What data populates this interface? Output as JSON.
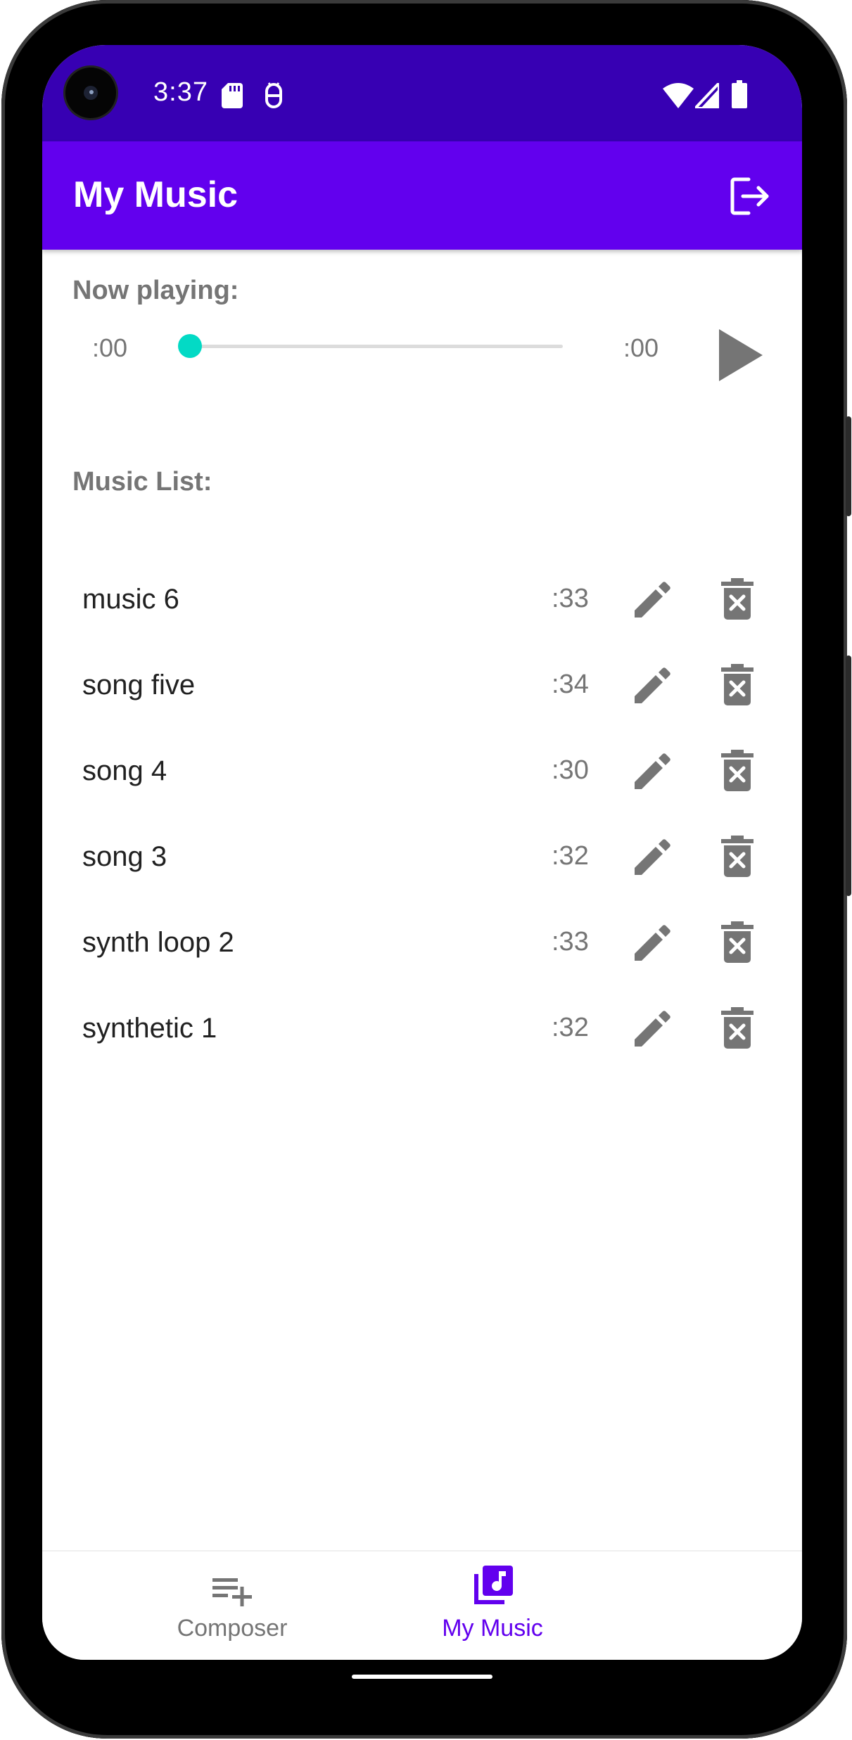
{
  "status_bar": {
    "time": "3:37",
    "icons": [
      "sd-card-icon",
      "debug-icon",
      "wifi-icon",
      "signal-icon",
      "battery-icon"
    ]
  },
  "app_bar": {
    "title": "My Music",
    "action_icon": "logout-icon"
  },
  "player": {
    "label": "Now playing:",
    "current_time": ":00",
    "total_time": ":00",
    "progress": 0,
    "play_icon": "play-icon"
  },
  "music_list": {
    "label": "Music List:",
    "items": [
      {
        "name": "music 6",
        "duration": ":33"
      },
      {
        "name": "song five",
        "duration": ":34"
      },
      {
        "name": "song 4",
        "duration": ":30"
      },
      {
        "name": "song 3",
        "duration": ":32"
      },
      {
        "name": "synth loop 2",
        "duration": ":33"
      },
      {
        "name": "synthetic 1",
        "duration": ":32"
      }
    ]
  },
  "bottom_nav": {
    "items": [
      {
        "label": "Composer",
        "icon": "playlist-add-icon",
        "selected": false
      },
      {
        "label": "My Music",
        "icon": "library-music-icon",
        "selected": true
      }
    ]
  },
  "colors": {
    "status_bar": "#3700b3",
    "app_bar": "#6200ee",
    "accent": "#03dac5",
    "icon_gray": "#757575",
    "nav_selected": "#6200ee"
  }
}
